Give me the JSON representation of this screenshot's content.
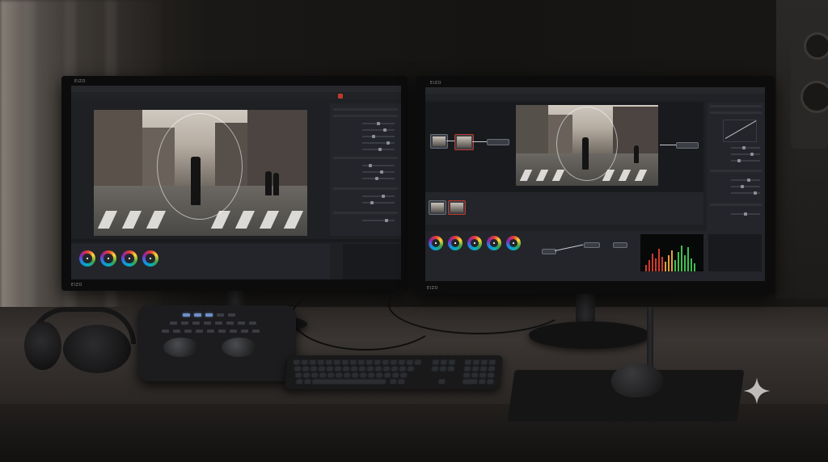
{
  "left_monitor": {
    "brand": "EIZO"
  },
  "right_monitor": {
    "brand": "EIZO"
  },
  "colors": {
    "ui_panel": "#23252a",
    "ui_background": "#1e2023",
    "accent_red": "#c0392b",
    "scope_red": "#d33a2c",
    "scope_green": "#3fbf4f"
  },
  "icons": [
    "sparkle-icon"
  ]
}
